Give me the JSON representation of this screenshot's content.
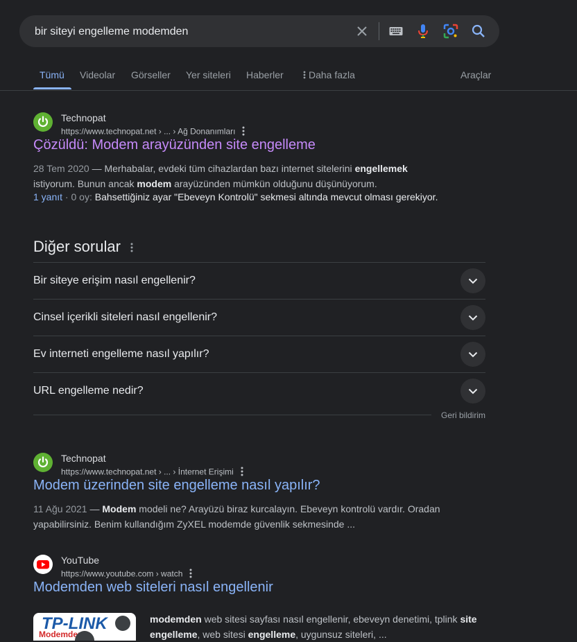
{
  "search": {
    "query": "bir siteyi engelleme modemden"
  },
  "tabs": [
    {
      "label": "Tümü"
    },
    {
      "label": "Videolar"
    },
    {
      "label": "Görseller"
    },
    {
      "label": "Yer siteleri"
    },
    {
      "label": "Haberler"
    },
    {
      "label": "Daha fazla"
    }
  ],
  "tools_label": "Araçlar",
  "results": [
    {
      "site": "Technopat",
      "url": "https://www.technopat.net › ... › Ağ Donanımları",
      "title": "Çözüldü: Modem arayüzünden site engelleme",
      "date": "28 Tem 2020",
      "snippet_parts": [
        "Merhabalar, evdeki tüm cihazlardan bazı internet sitelerini ",
        "engellemek",
        " istiyorum. Bunun ancak ",
        "modem",
        " arayüzünden mümkün olduğunu düşünüyorum."
      ],
      "replies": "1 yanıt",
      "votes": "0 oy:",
      "answer": "Bahsettiğiniz ayar \"Ebeveyn Kontrolü\" sekmesi altında mevcut olması gerekiyor."
    },
    {
      "site": "Technopat",
      "url": "https://www.technopat.net › ... › İnternet Erişimi",
      "title": "Modem üzerinden site engelleme nasıl yapılır?",
      "date": "11 Ağu 2021",
      "snippet_parts": [
        "Modem",
        " modeli ne? Arayüzü biraz kurcalayın. Ebeveyn kontrolü vardır. Oradan yapabilirsiniz. Benim kullandığım ZyXEL modemde güvenlik sekmesinde ..."
      ]
    },
    {
      "site": "YouTube",
      "url": "https://www.youtube.com › watch",
      "title": "Modemden web siteleri nasıl engellenir",
      "thumb_logo": "TP-LINK",
      "thumb_sub": "Modemden",
      "snippet_parts": [
        "modemden",
        " web sitesi sayfası nasıl engellenir, ebeveyn denetimi, tplink ",
        "site engelleme",
        ", web sitesi ",
        "engelleme",
        ", uygunsuz siteleri, ..."
      ]
    }
  ],
  "paa": {
    "title": "Diğer sorular",
    "questions": [
      "Bir siteye erişim nasıl engellenir?",
      "Cinsel içerikli siteleri nasıl engellenir?",
      "Ev interneti engelleme nasıl yapılır?",
      "URL engelleme nedir?"
    ],
    "feedback": "Geri bildirim"
  },
  "colors": {
    "background": "#202124",
    "link": "#8ab4f8",
    "visited": "#c58af9",
    "technopat_green": "#5fb133",
    "youtube_red": "#ff0000"
  },
  "icons": [
    "clear-icon",
    "keyboard-icon",
    "microphone-icon",
    "lens-icon",
    "search-icon",
    "more-dots-icon",
    "kebab-icon",
    "chevron-down-icon",
    "power-icon",
    "youtube-play-icon"
  ]
}
